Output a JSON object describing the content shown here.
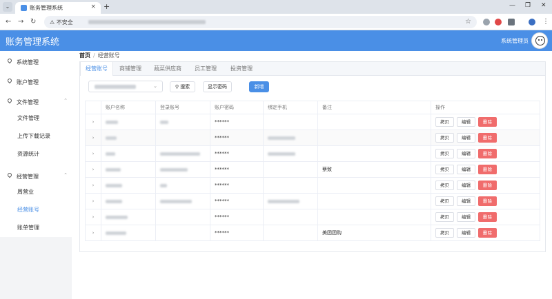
{
  "browser": {
    "tab_title": "账务管理系统",
    "secure_label": "不安全"
  },
  "header": {
    "title": "账务管理系统",
    "user": "系统管理员"
  },
  "sidebar": {
    "groups": [
      {
        "label": "系统管理"
      },
      {
        "label": "账户管理"
      },
      {
        "label": "文件管理",
        "items": [
          "文件管理",
          "上传下载记录",
          "资源统计"
        ]
      },
      {
        "label": "经营管理",
        "items": [
          "周营业",
          "经营账号",
          "账单管理"
        ]
      }
    ],
    "active": "经营账号"
  },
  "breadcrumb": {
    "home": "首页",
    "current": "经营账号"
  },
  "tabs": [
    "经营账号",
    "商铺管理",
    "蔬菜供应商",
    "员工管理",
    "投资管理"
  ],
  "toolbar": {
    "search_label": "搜索",
    "show_password_label": "显示密码",
    "add_label": "新增"
  },
  "table": {
    "columns": [
      "账户名称",
      "登录账号",
      "账户密码",
      "绑定手机",
      "备注",
      "操作"
    ],
    "rows": [
      {
        "password": "******",
        "note": ""
      },
      {
        "password": "******",
        "note": ""
      },
      {
        "password": "******",
        "note": ""
      },
      {
        "password": "******",
        "note": "蔡致"
      },
      {
        "password": "******",
        "note": ""
      },
      {
        "password": "******",
        "note": ""
      },
      {
        "password": "******",
        "note": ""
      },
      {
        "password": "******",
        "note": "美团团购"
      }
    ],
    "actions": {
      "copy": "拷贝",
      "edit": "编辑",
      "delete": "删除"
    }
  },
  "colors": {
    "accent": "#4a8fe6",
    "danger": "#f06c6c"
  }
}
